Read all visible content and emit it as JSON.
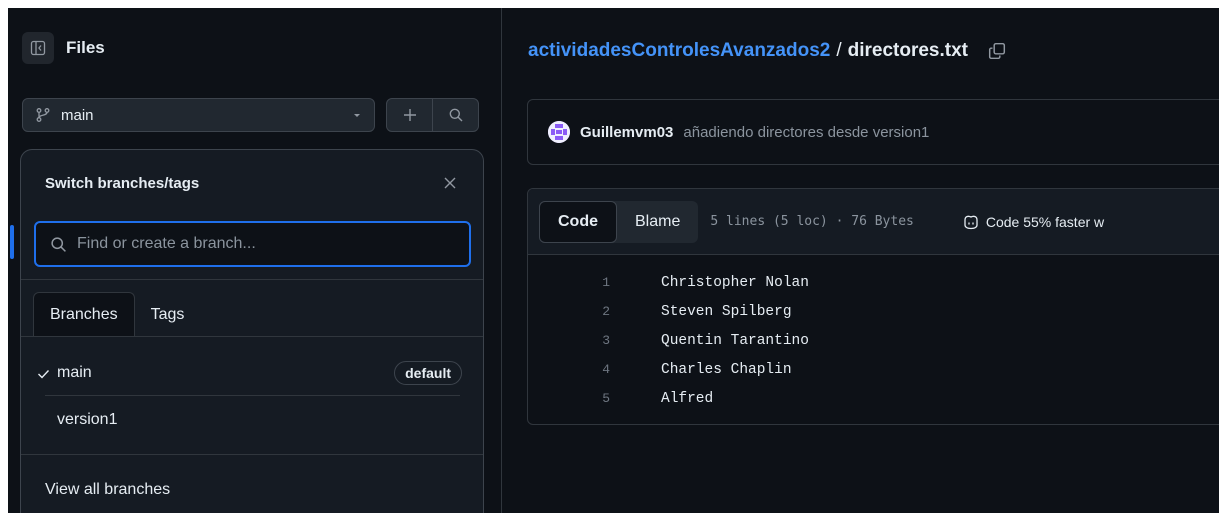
{
  "sidebar": {
    "title": "Files",
    "branch_select": {
      "value": "main"
    }
  },
  "branch_dropdown": {
    "title": "Switch branches/tags",
    "search": {
      "placeholder": "Find or create a branch..."
    },
    "tabs": [
      {
        "label": "Branches",
        "active": true
      },
      {
        "label": "Tags",
        "active": false
      }
    ],
    "branches": [
      {
        "name": "main",
        "selected": true,
        "badge": "default"
      },
      {
        "name": "version1",
        "selected": false
      }
    ],
    "view_all_label": "View all branches"
  },
  "breadcrumb": {
    "repo": "actividadesControlesAvanzados2",
    "separator": "/",
    "file": "directores.txt"
  },
  "commit": {
    "author": "Guillemvm03",
    "message": "añadiendo directores desde version1"
  },
  "code_view": {
    "tabs": [
      {
        "label": "Code",
        "active": true
      },
      {
        "label": "Blame",
        "active": false
      }
    ],
    "meta": "5 lines (5 loc) · 76 Bytes",
    "copilot_text": "Code 55% faster w",
    "lines": [
      {
        "num": "1",
        "text": "Christopher Nolan"
      },
      {
        "num": "2",
        "text": "Steven Spilberg"
      },
      {
        "num": "3",
        "text": "Quentin Tarantino"
      },
      {
        "num": "4",
        "text": "Charles Chaplin"
      },
      {
        "num": "5",
        "text": "Alfred"
      }
    ]
  },
  "colors": {
    "background": "#0d1117",
    "accent": "#1f6feb",
    "link": "#4493f8",
    "border": "#30363d"
  }
}
